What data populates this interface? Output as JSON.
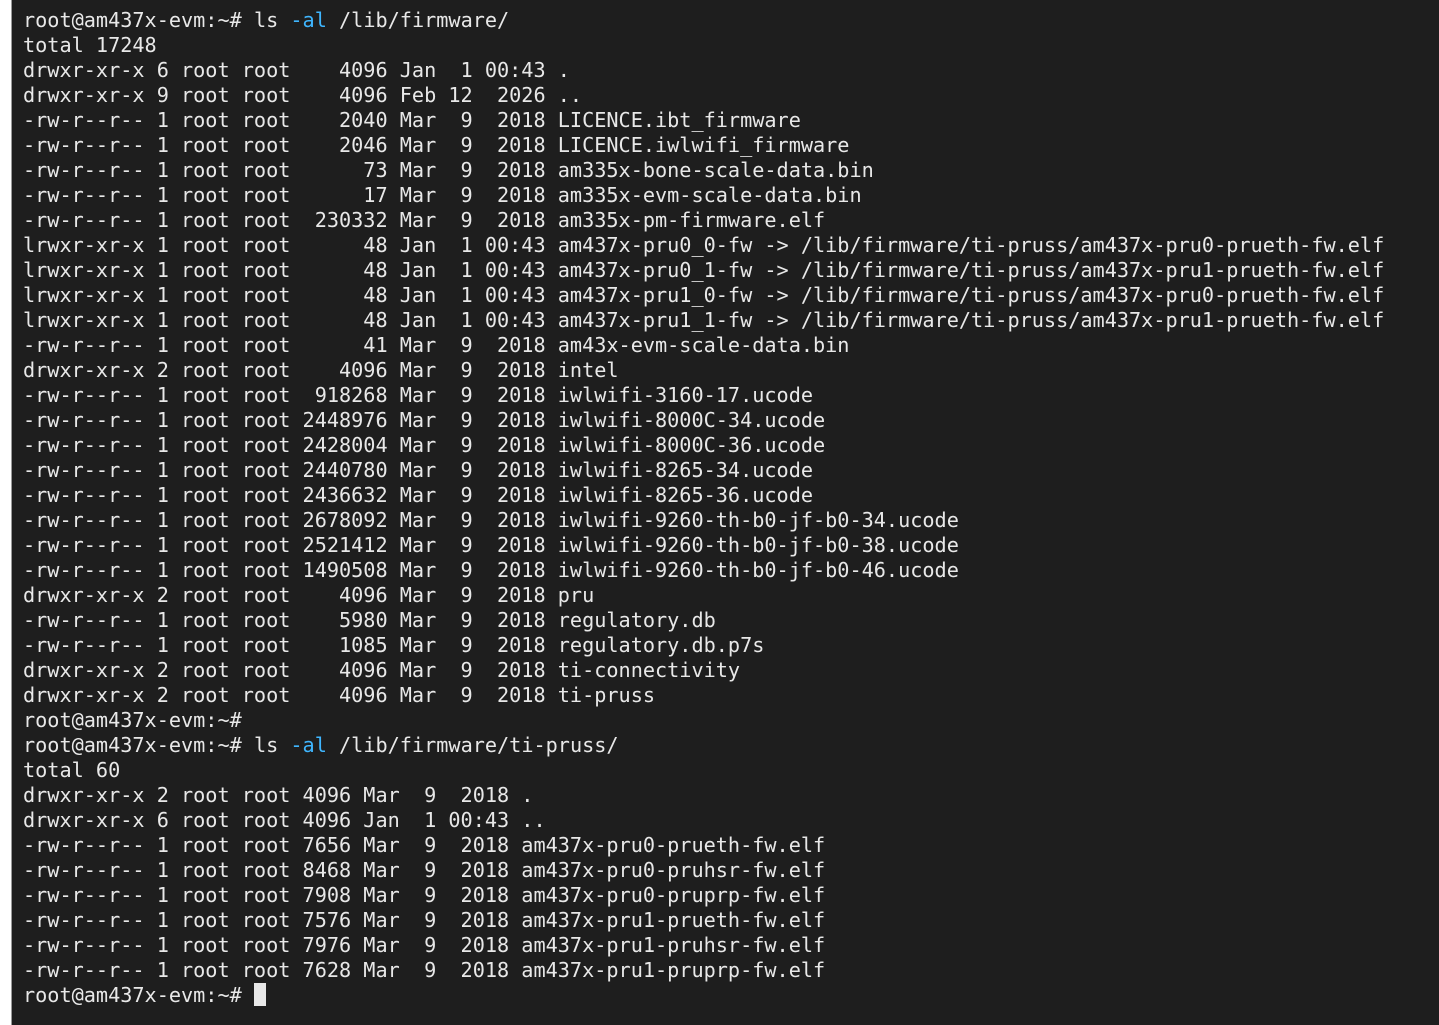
{
  "terminal": {
    "colors": {
      "background": "#1e1e1e",
      "foreground": "#e8e8e8",
      "flag": "#3fb6ff",
      "cursor": "#e8e8e8"
    },
    "lines": [
      {
        "type": "command",
        "prompt": "root@am437x-evm:~# ",
        "cmd": "ls ",
        "flag": "-al",
        "args": " /lib/firmware/"
      },
      {
        "type": "text",
        "text": "total 17248"
      },
      {
        "type": "text",
        "text": "drwxr-xr-x 6 root root    4096 Jan  1 00:43 ."
      },
      {
        "type": "text",
        "text": "drwxr-xr-x 9 root root    4096 Feb 12  2026 .."
      },
      {
        "type": "text",
        "text": "-rw-r--r-- 1 root root    2040 Mar  9  2018 LICENCE.ibt_firmware"
      },
      {
        "type": "text",
        "text": "-rw-r--r-- 1 root root    2046 Mar  9  2018 LICENCE.iwlwifi_firmware"
      },
      {
        "type": "text",
        "text": "-rw-r--r-- 1 root root      73 Mar  9  2018 am335x-bone-scale-data.bin"
      },
      {
        "type": "text",
        "text": "-rw-r--r-- 1 root root      17 Mar  9  2018 am335x-evm-scale-data.bin"
      },
      {
        "type": "text",
        "text": "-rw-r--r-- 1 root root  230332 Mar  9  2018 am335x-pm-firmware.elf"
      },
      {
        "type": "text",
        "text": "lrwxr-xr-x 1 root root      48 Jan  1 00:43 am437x-pru0_0-fw -> /lib/firmware/ti-pruss/am437x-pru0-prueth-fw.elf"
      },
      {
        "type": "text",
        "text": "lrwxr-xr-x 1 root root      48 Jan  1 00:43 am437x-pru0_1-fw -> /lib/firmware/ti-pruss/am437x-pru1-prueth-fw.elf"
      },
      {
        "type": "text",
        "text": "lrwxr-xr-x 1 root root      48 Jan  1 00:43 am437x-pru1_0-fw -> /lib/firmware/ti-pruss/am437x-pru0-prueth-fw.elf"
      },
      {
        "type": "text",
        "text": "lrwxr-xr-x 1 root root      48 Jan  1 00:43 am437x-pru1_1-fw -> /lib/firmware/ti-pruss/am437x-pru1-prueth-fw.elf"
      },
      {
        "type": "text",
        "text": "-rw-r--r-- 1 root root      41 Mar  9  2018 am43x-evm-scale-data.bin"
      },
      {
        "type": "text",
        "text": "drwxr-xr-x 2 root root    4096 Mar  9  2018 intel"
      },
      {
        "type": "text",
        "text": "-rw-r--r-- 1 root root  918268 Mar  9  2018 iwlwifi-3160-17.ucode"
      },
      {
        "type": "text",
        "text": "-rw-r--r-- 1 root root 2448976 Mar  9  2018 iwlwifi-8000C-34.ucode"
      },
      {
        "type": "text",
        "text": "-rw-r--r-- 1 root root 2428004 Mar  9  2018 iwlwifi-8000C-36.ucode"
      },
      {
        "type": "text",
        "text": "-rw-r--r-- 1 root root 2440780 Mar  9  2018 iwlwifi-8265-34.ucode"
      },
      {
        "type": "text",
        "text": "-rw-r--r-- 1 root root 2436632 Mar  9  2018 iwlwifi-8265-36.ucode"
      },
      {
        "type": "text",
        "text": "-rw-r--r-- 1 root root 2678092 Mar  9  2018 iwlwifi-9260-th-b0-jf-b0-34.ucode"
      },
      {
        "type": "text",
        "text": "-rw-r--r-- 1 root root 2521412 Mar  9  2018 iwlwifi-9260-th-b0-jf-b0-38.ucode"
      },
      {
        "type": "text",
        "text": "-rw-r--r-- 1 root root 1490508 Mar  9  2018 iwlwifi-9260-th-b0-jf-b0-46.ucode"
      },
      {
        "type": "text",
        "text": "drwxr-xr-x 2 root root    4096 Mar  9  2018 pru"
      },
      {
        "type": "text",
        "text": "-rw-r--r-- 1 root root    5980 Mar  9  2018 regulatory.db"
      },
      {
        "type": "text",
        "text": "-rw-r--r-- 1 root root    1085 Mar  9  2018 regulatory.db.p7s"
      },
      {
        "type": "text",
        "text": "drwxr-xr-x 2 root root    4096 Mar  9  2018 ti-connectivity"
      },
      {
        "type": "text",
        "text": "drwxr-xr-x 2 root root    4096 Mar  9  2018 ti-pruss"
      },
      {
        "type": "prompt",
        "prompt": "root@am437x-evm:~#"
      },
      {
        "type": "command",
        "prompt": "root@am437x-evm:~# ",
        "cmd": "ls ",
        "flag": "-al",
        "args": " /lib/firmware/ti-pruss/"
      },
      {
        "type": "text",
        "text": "total 60"
      },
      {
        "type": "text",
        "text": "drwxr-xr-x 2 root root 4096 Mar  9  2018 ."
      },
      {
        "type": "text",
        "text": "drwxr-xr-x 6 root root 4096 Jan  1 00:43 .."
      },
      {
        "type": "text",
        "text": "-rw-r--r-- 1 root root 7656 Mar  9  2018 am437x-pru0-prueth-fw.elf"
      },
      {
        "type": "text",
        "text": "-rw-r--r-- 1 root root 8468 Mar  9  2018 am437x-pru0-pruhsr-fw.elf"
      },
      {
        "type": "text",
        "text": "-rw-r--r-- 1 root root 7908 Mar  9  2018 am437x-pru0-pruprp-fw.elf"
      },
      {
        "type": "text",
        "text": "-rw-r--r-- 1 root root 7576 Mar  9  2018 am437x-pru1-prueth-fw.elf"
      },
      {
        "type": "text",
        "text": "-rw-r--r-- 1 root root 7976 Mar  9  2018 am437x-pru1-pruhsr-fw.elf"
      },
      {
        "type": "text",
        "text": "-rw-r--r-- 1 root root 7628 Mar  9  2018 am437x-pru1-pruprp-fw.elf"
      },
      {
        "type": "prompt_cursor",
        "prompt": "root@am437x-evm:~# "
      }
    ]
  }
}
